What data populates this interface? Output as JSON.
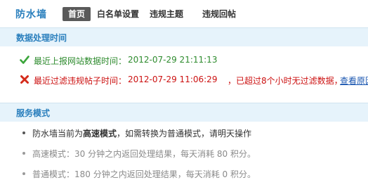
{
  "header": {
    "title": "防水墙",
    "tabs": [
      {
        "label": "首页",
        "active": true
      },
      {
        "label": "白名单设置",
        "active": false
      },
      {
        "label": "违规主题",
        "active": false
      },
      {
        "label": "违规回帖",
        "active": false
      }
    ]
  },
  "data_section": {
    "title": "数据处理时间",
    "last_report": {
      "label": "最近上报网站数据时间：",
      "value": "2012-07-29 21:11:13",
      "icon": "check-icon"
    },
    "last_filter": {
      "label": "最近过滤违规帖子时间：",
      "value": "2012-07-29 11:06:29",
      "warning": "，已超过8个小时无过滤数据，",
      "link": "查看原因",
      "icon": "error-icon"
    }
  },
  "mode_section": {
    "title": "服务模式",
    "current_prefix": "防水墙当前为",
    "current_mode": "高速模式",
    "current_suffix": "，如需转换为普通模式，请明天操作",
    "fast_mode": "高速模式：30 分钟之内返回处理结果，每天消耗  80 积分。",
    "normal_mode": "普通模式：180 分钟之内返回处理结果，每天消耗  0 积分。"
  },
  "colors": {
    "accent": "#2a7fbd",
    "section_bg": "#e6f3fb",
    "ok": "#2e8b2e",
    "error": "#cc1111",
    "link": "#1a56b0"
  }
}
